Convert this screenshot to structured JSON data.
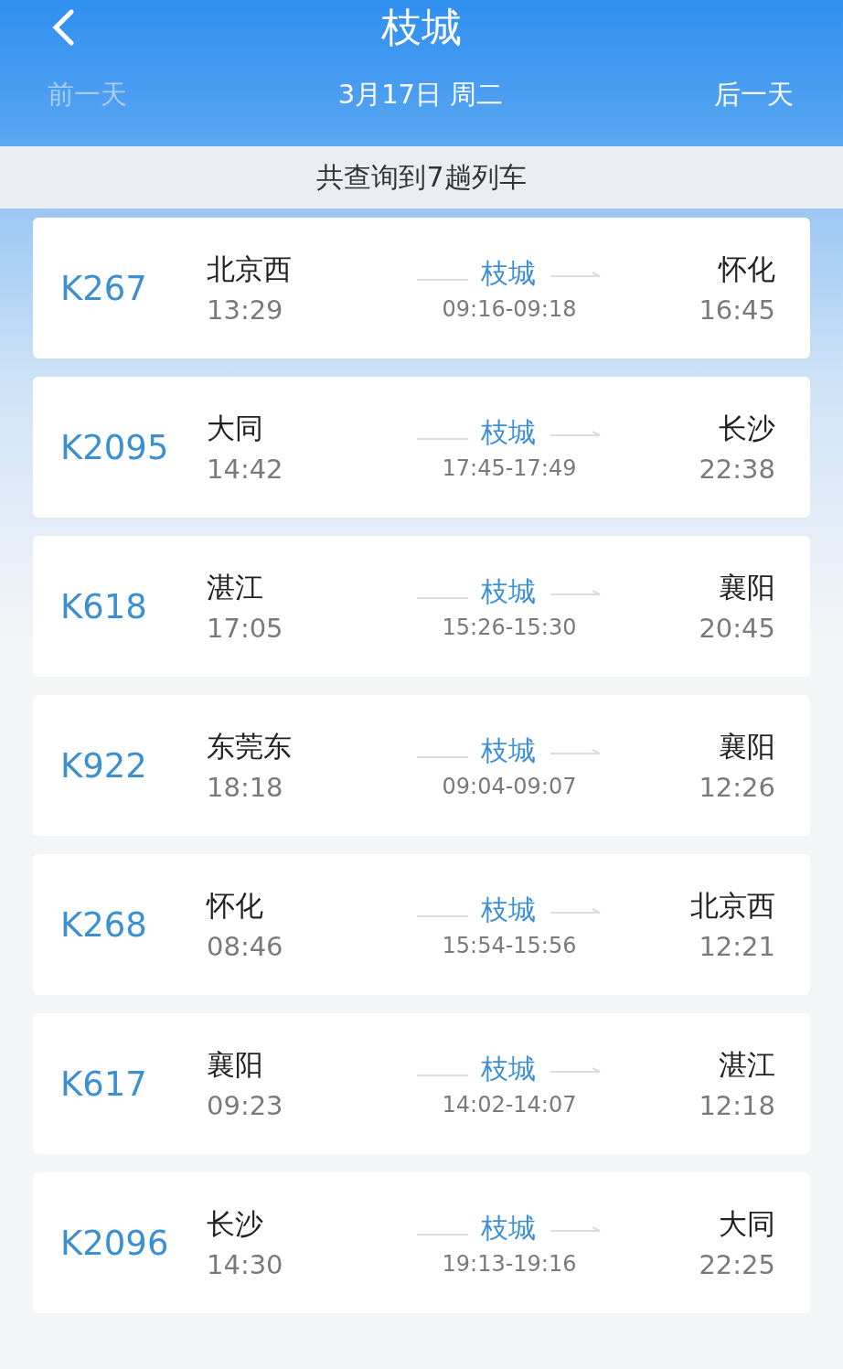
{
  "header": {
    "title": "枝城",
    "prev_day": {
      "label": "前一天",
      "disabled": true
    },
    "date": "3月17日 周二",
    "next_day": {
      "label": "后一天",
      "disabled": false
    }
  },
  "summary": "共查询到7趟列车",
  "trains": [
    {
      "number": "K267",
      "from": "北京西",
      "depart": "13:29",
      "station": "枝城",
      "stop_time": "09:16-09:18",
      "to": "怀化",
      "arrive": "16:45"
    },
    {
      "number": "K2095",
      "from": "大同",
      "depart": "14:42",
      "station": "枝城",
      "stop_time": "17:45-17:49",
      "to": "长沙",
      "arrive": "22:38"
    },
    {
      "number": "K618",
      "from": "湛江",
      "depart": "17:05",
      "station": "枝城",
      "stop_time": "15:26-15:30",
      "to": "襄阳",
      "arrive": "20:45"
    },
    {
      "number": "K922",
      "from": "东莞东",
      "depart": "18:18",
      "station": "枝城",
      "stop_time": "09:04-09:07",
      "to": "襄阳",
      "arrive": "12:26"
    },
    {
      "number": "K268",
      "from": "怀化",
      "depart": "08:46",
      "station": "枝城",
      "stop_time": "15:54-15:56",
      "to": "北京西",
      "arrive": "12:21"
    },
    {
      "number": "K617",
      "from": "襄阳",
      "depart": "09:23",
      "station": "枝城",
      "stop_time": "14:02-14:07",
      "to": "湛江",
      "arrive": "12:18"
    },
    {
      "number": "K2096",
      "from": "长沙",
      "depart": "14:30",
      "station": "枝城",
      "stop_time": "19:13-19:16",
      "to": "大同",
      "arrive": "22:25"
    }
  ]
}
